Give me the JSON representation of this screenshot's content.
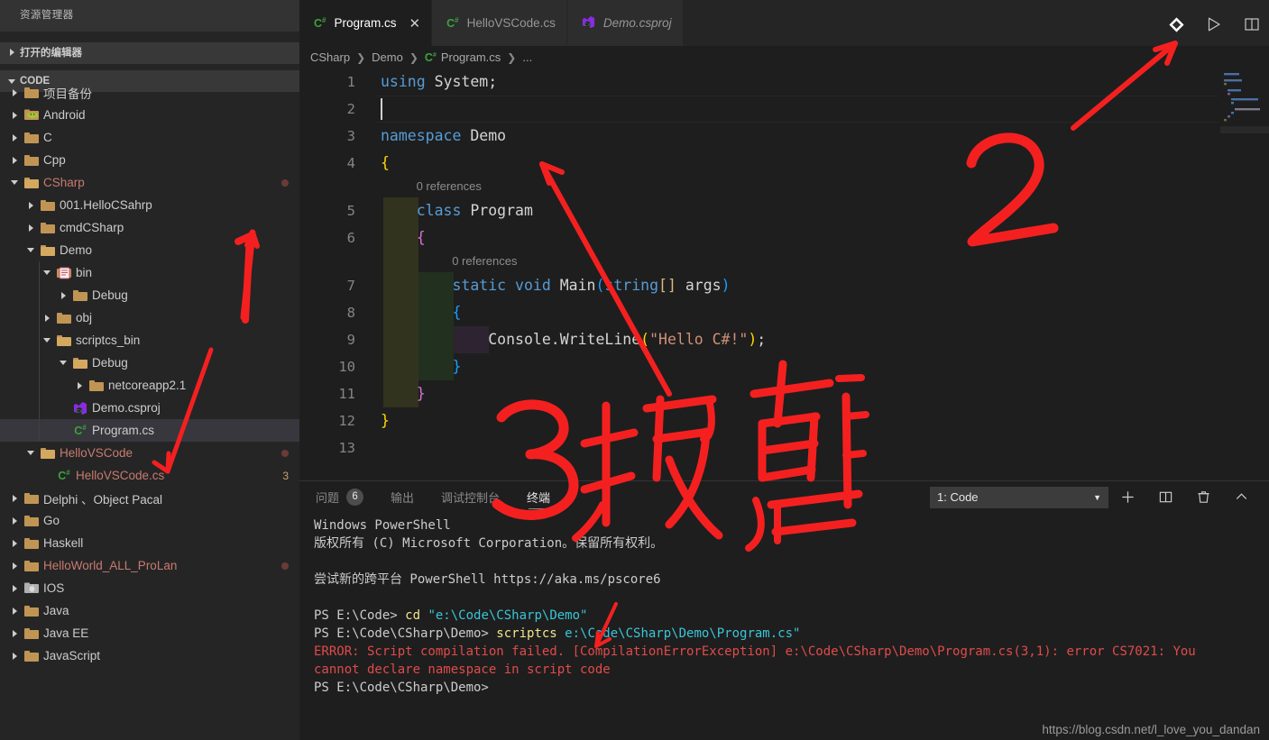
{
  "sidebar": {
    "title": "资源管理器",
    "sections": [
      {
        "label": "打开的编辑器",
        "expanded": false
      },
      {
        "label": "CODE",
        "expanded": true
      }
    ],
    "tree": [
      {
        "label": "项目备份",
        "indent": 0,
        "icon": "folder-icon",
        "arrow": "right",
        "color": "normal"
      },
      {
        "label": "Android",
        "indent": 0,
        "icon": "android-folder-icon",
        "arrow": "right",
        "color": "normal"
      },
      {
        "label": "C",
        "indent": 0,
        "icon": "folder-icon",
        "arrow": "right",
        "color": "normal"
      },
      {
        "label": "Cpp",
        "indent": 0,
        "icon": "folder-icon",
        "arrow": "right",
        "color": "normal"
      },
      {
        "label": "CSharp",
        "indent": 0,
        "icon": "folder-open-icon",
        "arrow": "down",
        "color": "red",
        "dot": true
      },
      {
        "label": "001.HelloCSahrp",
        "indent": 1,
        "icon": "folder-icon",
        "arrow": "right",
        "color": "normal"
      },
      {
        "label": "cmdCSharp",
        "indent": 1,
        "icon": "folder-icon",
        "arrow": "right",
        "color": "normal"
      },
      {
        "label": "Demo",
        "indent": 1,
        "icon": "folder-open-icon",
        "arrow": "down",
        "color": "normal"
      },
      {
        "label": "bin",
        "indent": 2,
        "icon": "bin-folder-icon",
        "arrow": "down",
        "color": "normal"
      },
      {
        "label": "Debug",
        "indent": 3,
        "icon": "folder-icon",
        "arrow": "right",
        "color": "normal"
      },
      {
        "label": "obj",
        "indent": 2,
        "icon": "folder-icon",
        "arrow": "right",
        "color": "normal"
      },
      {
        "label": "scriptcs_bin",
        "indent": 2,
        "icon": "folder-open-icon",
        "arrow": "down",
        "color": "normal"
      },
      {
        "label": "Debug",
        "indent": 3,
        "icon": "folder-open-icon",
        "arrow": "down",
        "color": "normal"
      },
      {
        "label": "netcoreapp2.1",
        "indent": 4,
        "icon": "folder-icon",
        "arrow": "right",
        "color": "normal"
      },
      {
        "label": "Demo.csproj",
        "indent": 3,
        "icon": "csproj-file-icon",
        "arrow": "none",
        "color": "normal"
      },
      {
        "label": "Program.cs",
        "indent": 3,
        "icon": "csharp-file-icon",
        "arrow": "none",
        "color": "normal",
        "selected": true
      },
      {
        "label": "HelloVSCode",
        "indent": 1,
        "icon": "folder-open-icon",
        "arrow": "down",
        "color": "red",
        "dot": true
      },
      {
        "label": "HelloVSCode.cs",
        "indent": 2,
        "icon": "csharp-file-icon",
        "arrow": "none",
        "color": "red",
        "count": "3"
      },
      {
        "label": "Delphi 、Object Pacal",
        "indent": 0,
        "icon": "folder-icon",
        "arrow": "right",
        "color": "normal"
      },
      {
        "label": "Go",
        "indent": 0,
        "icon": "folder-icon",
        "arrow": "right",
        "color": "normal"
      },
      {
        "label": "Haskell",
        "indent": 0,
        "icon": "folder-icon",
        "arrow": "right",
        "color": "normal"
      },
      {
        "label": "HelloWorld_ALL_ProLan",
        "indent": 0,
        "icon": "folder-icon",
        "arrow": "right",
        "color": "red",
        "dot": true
      },
      {
        "label": "IOS",
        "indent": 0,
        "icon": "ios-folder-icon",
        "arrow": "right",
        "color": "normal"
      },
      {
        "label": "Java",
        "indent": 0,
        "icon": "folder-icon",
        "arrow": "right",
        "color": "normal"
      },
      {
        "label": "Java EE",
        "indent": 0,
        "icon": "folder-icon",
        "arrow": "right",
        "color": "normal"
      },
      {
        "label": "JavaScript",
        "indent": 0,
        "icon": "folder-icon",
        "arrow": "right",
        "color": "normal"
      }
    ]
  },
  "tabs": [
    {
      "label": "Program.cs",
      "icon": "csharp-file-icon",
      "active": true,
      "italic": false,
      "close": "✕"
    },
    {
      "label": "HelloVSCode.cs",
      "icon": "csharp-file-icon",
      "active": false,
      "italic": false
    },
    {
      "label": "Demo.csproj",
      "icon": "csproj-file-icon",
      "active": false,
      "italic": true
    }
  ],
  "titlebar_icons": [
    "source-control-icon",
    "run-icon",
    "split-editor-icon"
  ],
  "breadcrumb": [
    "CSharp",
    "Demo",
    "Program.cs",
    "..."
  ],
  "editor": {
    "lines": [
      {
        "n": "1",
        "text": "using System;"
      },
      {
        "n": "2",
        "text": ""
      },
      {
        "n": "3",
        "text": "namespace Demo"
      },
      {
        "n": "4",
        "text": "{"
      },
      {
        "n": "5",
        "text": "    class Program"
      },
      {
        "n": "6",
        "text": "    {"
      },
      {
        "n": "7",
        "text": "        static void Main(string[] args)"
      },
      {
        "n": "8",
        "text": "        {"
      },
      {
        "n": "9",
        "text": "            Console.WriteLine(\"Hello C#!\");"
      },
      {
        "n": "10",
        "text": "        }"
      },
      {
        "n": "11",
        "text": "    }"
      },
      {
        "n": "12",
        "text": "}"
      },
      {
        "n": "13",
        "text": ""
      }
    ],
    "codelens": [
      {
        "text": "0 references",
        "after_line": 4
      },
      {
        "text": "0 references",
        "after_line": 6
      }
    ],
    "cursor_line": 2
  },
  "panel": {
    "tabs": [
      {
        "label": "问题",
        "badge": "6",
        "active": false
      },
      {
        "label": "输出",
        "active": false
      },
      {
        "label": "调试控制台",
        "active": false
      },
      {
        "label": "终端",
        "active": true
      }
    ],
    "terminal_select": "1: Code",
    "actions": [
      "new-terminal-icon",
      "split-terminal-icon",
      "kill-terminal-icon",
      "collapse-panel-icon"
    ],
    "terminal_lines": [
      [
        {
          "t": "Windows PowerShell",
          "c": "white"
        }
      ],
      [
        {
          "t": "版权所有 (C) Microsoft Corporation。保留所有权利。",
          "c": "white"
        }
      ],
      [
        {
          "t": "",
          "c": "white"
        }
      ],
      [
        {
          "t": "尝试新的跨平台 PowerShell https://aka.ms/pscore6",
          "c": "white"
        }
      ],
      [
        {
          "t": "",
          "c": "white"
        }
      ],
      [
        {
          "t": "PS E:\\Code> ",
          "c": "white"
        },
        {
          "t": "cd ",
          "c": "yellow"
        },
        {
          "t": "\"e:\\Code\\CSharp\\Demo\"",
          "c": "cyan"
        }
      ],
      [
        {
          "t": "PS E:\\Code\\CSharp\\Demo> ",
          "c": "white"
        },
        {
          "t": "scriptcs ",
          "c": "yellow"
        },
        {
          "t": "e:\\Code\\CSharp\\Demo\\Program.cs\"",
          "c": "cyan"
        }
      ],
      [
        {
          "t": "ERROR: Script compilation failed. [CompilationErrorException] e:\\Code\\CSharp\\Demo\\Program.cs(3,1): error CS7021: You",
          "c": "red"
        }
      ],
      [
        {
          "t": "cannot declare namespace in script code",
          "c": "red"
        }
      ],
      [
        {
          "t": "PS E:\\Code\\CSharp\\Demo>",
          "c": "white"
        }
      ]
    ]
  },
  "watermark": "https://blog.csdn.net/l_love_you_dandan",
  "annotations": [
    {
      "name": "annotation-1",
      "text": "1"
    },
    {
      "name": "annotation-2",
      "text": "2"
    },
    {
      "name": "annotation-3",
      "text": "3报错"
    }
  ],
  "colors": {
    "accent_red": "#f42020",
    "editor_bg": "#1e1e1e",
    "sidebar_bg": "#252526",
    "selection": "#37373d"
  }
}
